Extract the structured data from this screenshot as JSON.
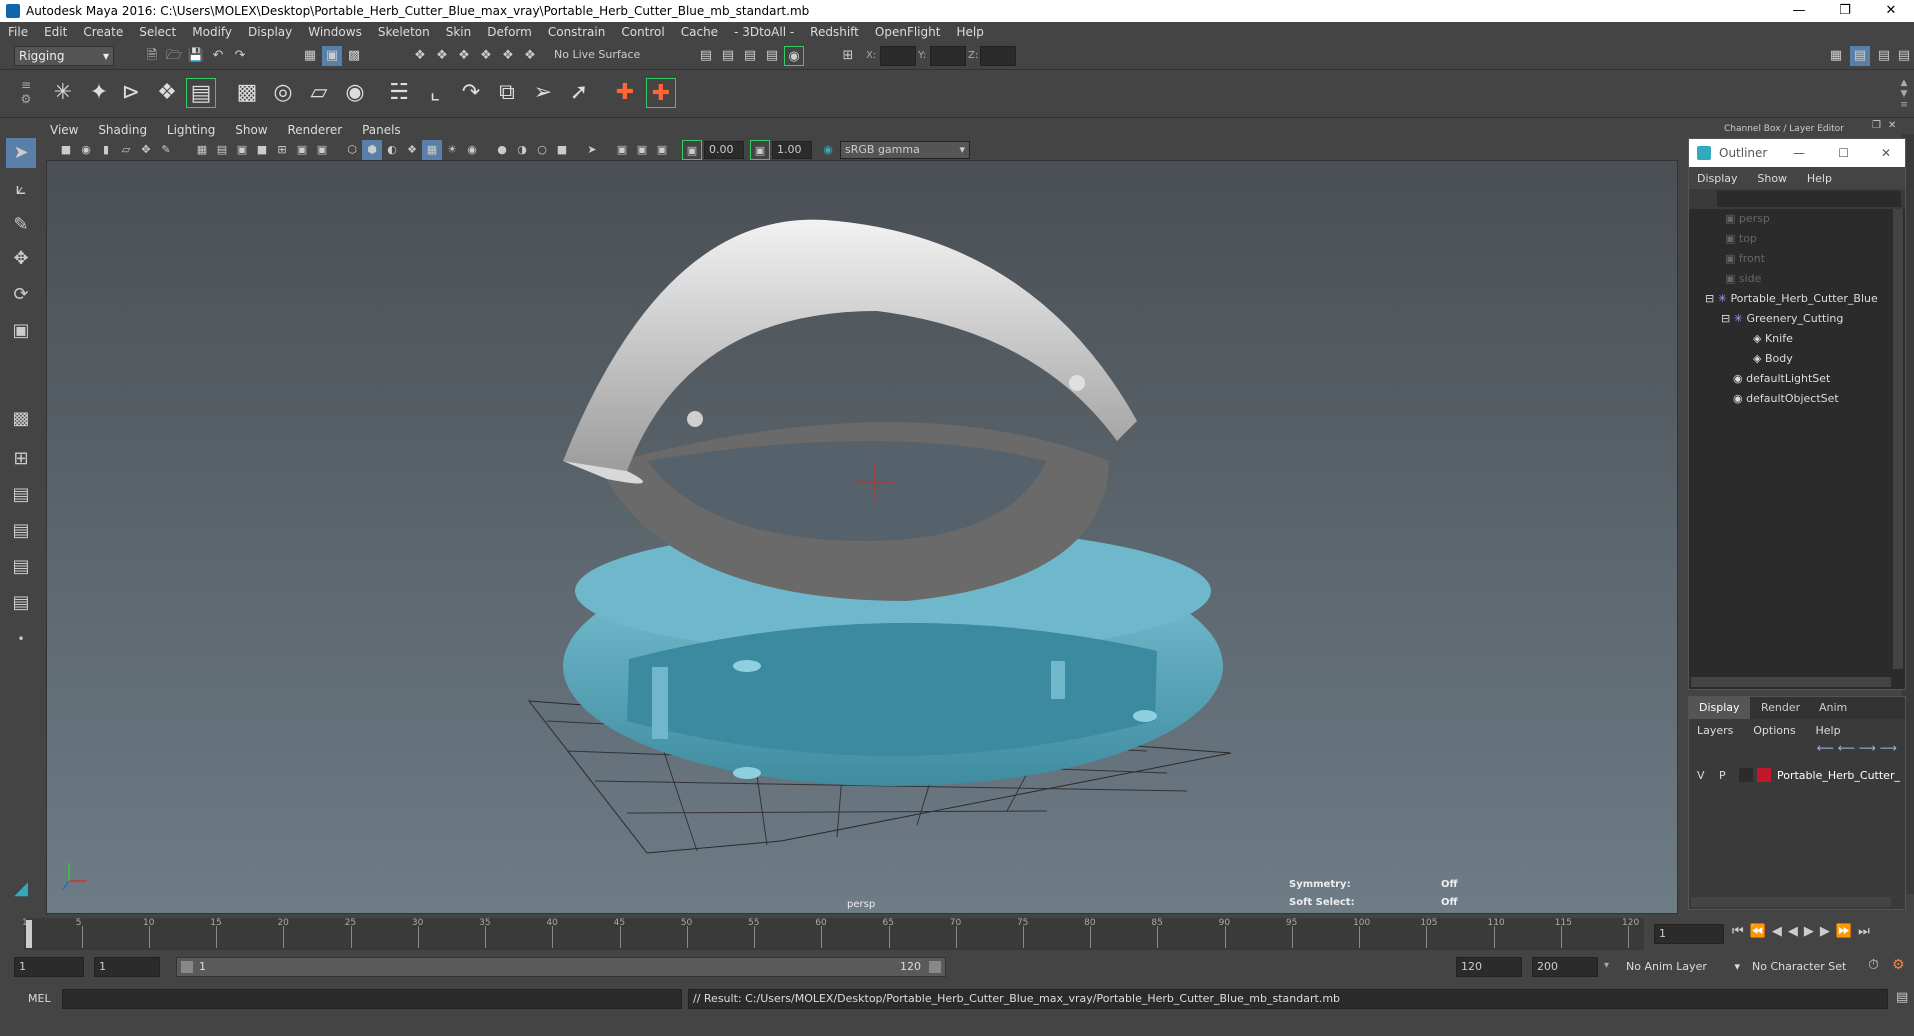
{
  "window": {
    "title": "Autodesk Maya 2016: C:\\Users\\MOLEX\\Desktop\\Portable_Herb_Cutter_Blue_max_vray\\Portable_Herb_Cutter_Blue_mb_standart.mb"
  },
  "menu": [
    "File",
    "Edit",
    "Create",
    "Select",
    "Modify",
    "Display",
    "Windows",
    "Skeleton",
    "Skin",
    "Deform",
    "Constrain",
    "Control",
    "Cache",
    "- 3DtoAll -",
    "Redshift",
    "OpenFlight",
    "Help"
  ],
  "status": {
    "mode": "Rigging",
    "live_surface": "No Live Surface",
    "x_label": "X:",
    "y_label": "Y:",
    "z_label": "Z:"
  },
  "viewport": {
    "menu": [
      "View",
      "Shading",
      "Lighting",
      "Show",
      "Renderer",
      "Panels"
    ],
    "exposure": "0.00",
    "gamma": "1.00",
    "colorspace": "sRGB gamma",
    "camera_label": "persp",
    "symmetry_label": "Symmetry:",
    "symmetry_value": "Off",
    "softselect_label": "Soft Select:",
    "softselect_value": "Off"
  },
  "channelbox": {
    "header": "Channel Box / Layer Editor"
  },
  "outliner": {
    "title": "Outliner",
    "menu": [
      "Display",
      "Show",
      "Help"
    ],
    "items": [
      {
        "label": "persp",
        "dim": true,
        "indent": 0
      },
      {
        "label": "top",
        "dim": true,
        "indent": 0
      },
      {
        "label": "front",
        "dim": true,
        "indent": 0
      },
      {
        "label": "side",
        "dim": true,
        "indent": 0
      },
      {
        "label": "Portable_Herb_Cutter_Blue",
        "dim": false,
        "indent": 0
      },
      {
        "label": "Greenery_Cutting",
        "dim": false,
        "indent": 1
      },
      {
        "label": "Knife",
        "dim": false,
        "indent": 2
      },
      {
        "label": "Body",
        "dim": false,
        "indent": 2
      },
      {
        "label": "defaultLightSet",
        "dim": false,
        "indent": 0
      },
      {
        "label": "defaultObjectSet",
        "dim": false,
        "indent": 0
      }
    ]
  },
  "layers": {
    "tabs": [
      "Display",
      "Render",
      "Anim"
    ],
    "menu": [
      "Layers",
      "Options",
      "Help"
    ],
    "row": {
      "v": "V",
      "p": "P",
      "name": "Portable_Herb_Cutter_",
      "color": "#c0182a"
    }
  },
  "timeline": {
    "ticks": [
      "1",
      "5",
      "10",
      "15",
      "20",
      "25",
      "30",
      "35",
      "40",
      "45",
      "50",
      "55",
      "60",
      "65",
      "70",
      "75",
      "80",
      "85",
      "90",
      "95",
      "100",
      "105",
      "110",
      "115",
      "120"
    ],
    "current_frame": "1"
  },
  "range": {
    "start": "1",
    "anim_start": "1",
    "slider_start": "1",
    "slider_end": "120",
    "end": "120",
    "anim_end": "200",
    "anim_layer": "No Anim Layer",
    "char_set": "No Character Set"
  },
  "command": {
    "lang": "MEL",
    "result": "// Result: C:/Users/MOLEX/Desktop/Portable_Herb_Cutter_Blue_max_vray/Portable_Herb_Cutter_Blue_mb_standart.mb"
  }
}
